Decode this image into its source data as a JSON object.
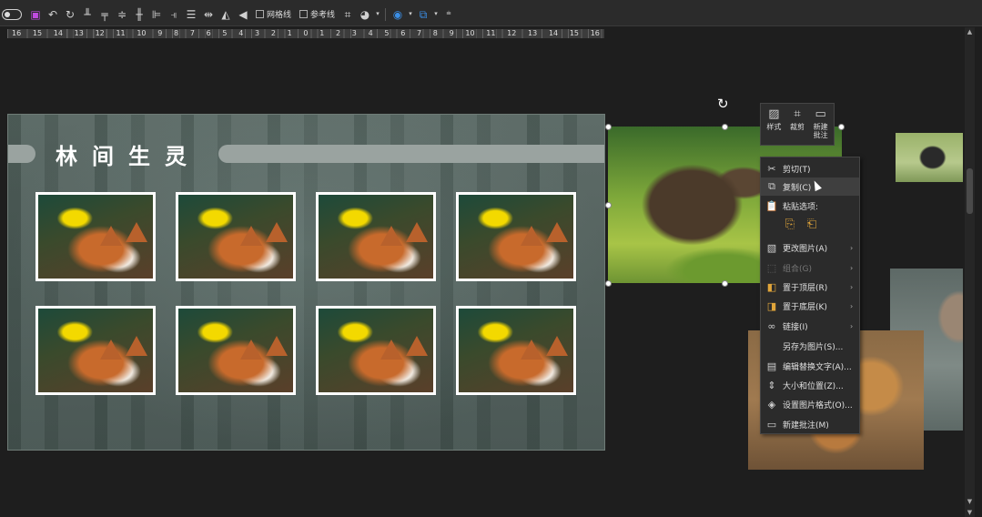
{
  "toolbar": {
    "gridlines_label": "网格线",
    "guides_label": "参考线",
    "icons": [
      "toggle-icon",
      "save-icon",
      "undo-icon",
      "redo-icon",
      "align-bottom-icon",
      "align-top-icon",
      "align-center-icon",
      "align-middle-icon",
      "align-left-icon",
      "align-right-icon",
      "distribute-vertical-icon",
      "flip-icon",
      "triangle-icon",
      "arrow-left-icon",
      "crop-icon",
      "shape-fill-icon",
      "color-circle-icon",
      "shape-outline-icon",
      "more-icon"
    ]
  },
  "ruler": {
    "labels": [
      "16",
      "15",
      "14",
      "13",
      "12",
      "11",
      "10",
      "9",
      "8",
      "7",
      "6",
      "5",
      "4",
      "3",
      "2",
      "1",
      "0",
      "1",
      "2",
      "3",
      "4",
      "5",
      "6",
      "7",
      "8",
      "9",
      "10",
      "11",
      "12",
      "13",
      "14",
      "15",
      "16"
    ]
  },
  "slide": {
    "title": "林间生灵",
    "photo_count": 8
  },
  "mini_toolbar": {
    "style_label": "样式",
    "crop_label": "裁剪",
    "new_comment_label_line1": "新建",
    "new_comment_label_line2": "批注"
  },
  "context_menu": {
    "items": [
      {
        "icon": "scissors-icon",
        "label": "剪切(T)"
      },
      {
        "icon": "copy-icon",
        "label": "复制(C)"
      },
      {
        "icon": "paste-icon",
        "label": "粘贴选项:"
      },
      {
        "icon": "change-picture-icon",
        "label": "更改图片(A)"
      },
      {
        "icon": "group-icon",
        "label": "组合(G)"
      },
      {
        "icon": "bring-front-icon",
        "label": "置于顶层(R)"
      },
      {
        "icon": "send-back-icon",
        "label": "置于底层(K)"
      },
      {
        "icon": "link-icon",
        "label": "链接(I)"
      },
      {
        "icon": "",
        "label": "另存为图片(S)..."
      },
      {
        "icon": "alt-text-icon",
        "label": "编辑替换文字(A)..."
      },
      {
        "icon": "size-position-icon",
        "label": "大小和位置(Z)..."
      },
      {
        "icon": "format-picture-icon",
        "label": "设置图片格式(O)..."
      },
      {
        "icon": "new-comment-icon",
        "label": "新建批注(M)"
      }
    ]
  },
  "colors": {
    "background": "#1e1e1e",
    "slide": "#556360",
    "menu": "#2b2b2b",
    "accent_purple": "#c04be0",
    "accent_blue": "#3a8ee6"
  }
}
